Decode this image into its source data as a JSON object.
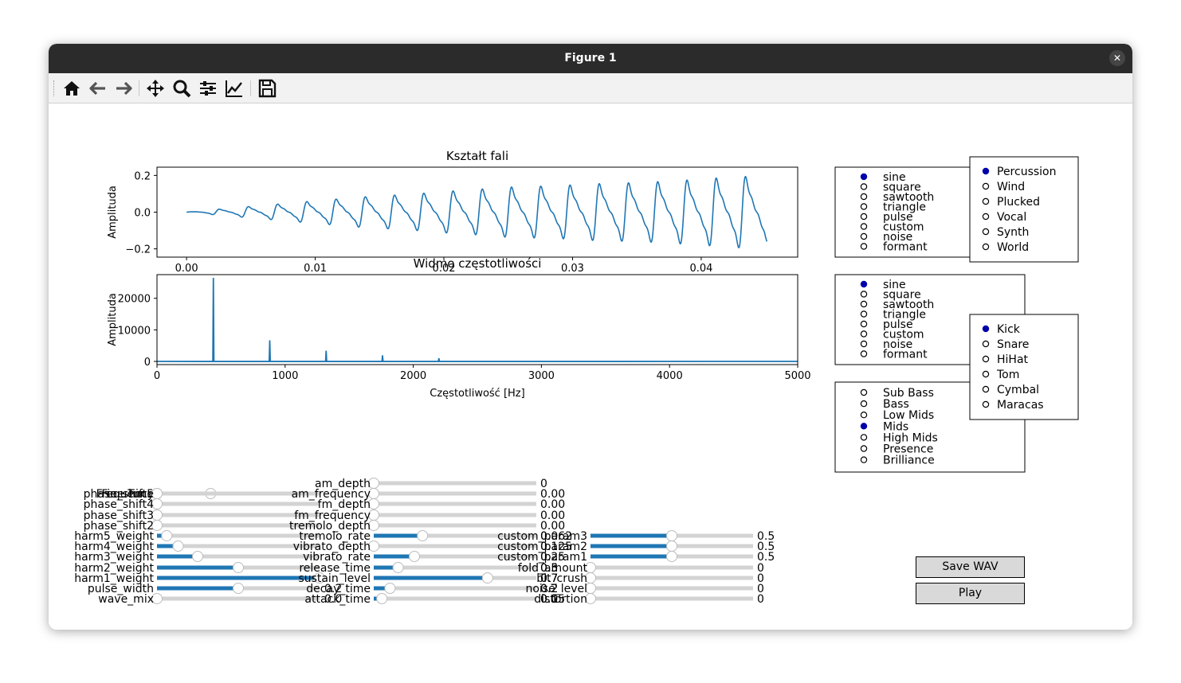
{
  "window": {
    "title": "Figure 1",
    "close_icon": "close-icon"
  },
  "toolbar": {
    "buttons": [
      {
        "name": "home-icon"
      },
      {
        "name": "back-icon"
      },
      {
        "name": "forward-icon"
      },
      {
        "name": "pan-icon"
      },
      {
        "name": "zoom-icon"
      },
      {
        "name": "configure-subplots-icon"
      },
      {
        "name": "edit-axis-icon"
      },
      {
        "name": "save-icon"
      }
    ]
  },
  "colors": {
    "line": "#1f77b4",
    "radio_active": "#0000aa",
    "slider_track": "#d3d3d3",
    "button_bg": "#d9d9d9"
  },
  "chart_data": [
    {
      "type": "line",
      "title": "Kształt fali",
      "xlabel": "",
      "ylabel": "Amplituda",
      "xlim": [
        -0.0023,
        0.0475
      ],
      "ylim": [
        -0.245,
        0.245
      ],
      "xticks": [
        0.0,
        0.01,
        0.02,
        0.03,
        0.04
      ],
      "xtick_labels": [
        "0.00",
        "0.01",
        "0.02",
        "0.03",
        "0.04"
      ],
      "yticks": [
        0.2,
        0.0,
        -0.2
      ],
      "ytick_labels": [
        "0.2",
        "0.0",
        "−0.2"
      ],
      "series": [
        {
          "peak_times": [
            0.0021,
            0.0043,
            0.0066,
            0.0088,
            0.0111,
            0.0133,
            0.0156,
            0.0178,
            0.0201,
            0.0223,
            0.0246,
            0.0268,
            0.0291,
            0.0313,
            0.0336,
            0.0358,
            0.0381,
            0.0403,
            0.0426
          ],
          "peak_amplitudes": [
            0.015,
            0.03,
            0.045,
            0.06,
            0.075,
            0.09,
            0.1,
            0.11,
            0.125,
            0.135,
            0.15,
            0.155,
            0.16,
            0.17,
            0.175,
            0.18,
            0.19,
            0.2,
            0.215
          ],
          "x_end": 0.045
        }
      ]
    },
    {
      "type": "line",
      "title": "Widmo częstotliwości",
      "xlabel": "Częstotliwość [Hz]",
      "ylabel": "Amplituda",
      "xlim": [
        0,
        5000
      ],
      "ylim": [
        -1000,
        27500
      ],
      "xticks": [
        0,
        1000,
        2000,
        3000,
        4000,
        5000
      ],
      "xtick_labels": [
        "0",
        "1000",
        "2000",
        "3000",
        "4000",
        "5000"
      ],
      "yticks": [
        20000,
        10000,
        0
      ],
      "ytick_labels": [
        "20000",
        "10000",
        "0"
      ],
      "series": [
        {
          "x": [
            440,
            880,
            1320,
            1760,
            2200
          ],
          "y": [
            26500,
            6700,
            3400,
            1900,
            1000
          ]
        }
      ]
    }
  ],
  "radios": {
    "wave1": {
      "options": [
        "sine",
        "square",
        "sawtooth",
        "triangle",
        "pulse",
        "custom",
        "noise",
        "formant"
      ],
      "selected": 0
    },
    "category": {
      "options": [
        "Percussion",
        "Wind",
        "Plucked",
        "Vocal",
        "Synth",
        "World"
      ],
      "selected": 0
    },
    "wave2": {
      "options": [
        "sine",
        "square",
        "sawtooth",
        "triangle",
        "pulse",
        "custom",
        "noise",
        "formant"
      ],
      "selected": 0
    },
    "drum": {
      "options": [
        "Kick",
        "Snare",
        "HiHat",
        "Tom",
        "Cymbal",
        "Maracas"
      ],
      "selected": 0
    },
    "band": {
      "options": [
        "Sub Bass",
        "Bass",
        "Low Mids",
        "Mids",
        "High Mids",
        "Presence",
        "Brilliance"
      ],
      "selected": 3
    }
  },
  "sliders": {
    "col1": [
      {
        "label": "Frequency",
        "value": 440,
        "frac": 0.33,
        "value_text": ""
      },
      {
        "label": "phase_shift5",
        "value": 0,
        "frac": 0,
        "value_text": ""
      },
      {
        "label": "Fine Tune",
        "value": 0,
        "frac": 0,
        "value_text": ""
      },
      {
        "label": "phase_shift4",
        "value": 0,
        "frac": 0,
        "value_text": ""
      },
      {
        "label": "phase_shift3",
        "value": 0,
        "frac": 0,
        "value_text": ""
      },
      {
        "label": "phase_shift2",
        "value": 0,
        "frac": 0,
        "value_text": ""
      },
      {
        "label": "harm5_weight",
        "value": 0.06,
        "frac": 0.06,
        "value_text": ""
      },
      {
        "label": "harm4_weight",
        "value": 0.13,
        "frac": 0.13,
        "value_text": ""
      },
      {
        "label": "harm3_weight",
        "value": 0.25,
        "frac": 0.25,
        "value_text": ""
      },
      {
        "label": "harm2_weight",
        "value": 0.5,
        "frac": 0.5,
        "value_text": ""
      },
      {
        "label": "harm1_weight",
        "value": 1.0,
        "frac": 1.0,
        "value_text": ""
      },
      {
        "label": "pulse_width",
        "value": 0.5,
        "frac": 0.5,
        "value_text": ""
      },
      {
        "label": "wave_mix",
        "value": 0,
        "frac": 0,
        "value_text": ""
      }
    ],
    "col2": [
      {
        "label": "am_depth",
        "value": 0,
        "frac": 0,
        "value_text": "0"
      },
      {
        "label": "am_frequency",
        "value": 0,
        "frac": 0,
        "value_text": "0.00"
      },
      {
        "label": "fm_depth",
        "value": 0,
        "frac": 0,
        "value_text": "0.00"
      },
      {
        "label": "fm_frequency",
        "value": 0,
        "frac": 0,
        "value_text": "0.00"
      },
      {
        "label": "tremolo_depth",
        "value": 0,
        "frac": 0,
        "value_text": "0.00"
      },
      {
        "label": "tremolo_rate",
        "value": 0.3,
        "frac": 0.3,
        "value_text": "0.062"
      },
      {
        "label": "vibrato_depth",
        "value": 0,
        "frac": 0,
        "value_text": "0.125"
      },
      {
        "label": "vibrato_rate",
        "value": 0.25,
        "frac": 0.25,
        "value_text": "0.25"
      },
      {
        "label": "release_time",
        "value": 0.15,
        "frac": 0.15,
        "value_text": "0.5"
      },
      {
        "label": "sustain_level",
        "value": 0.7,
        "frac": 0.7,
        "value_text": "0.7"
      },
      {
        "label": "decay_time",
        "value": 0.1,
        "frac": 0.1,
        "value_text": "0.2"
      },
      {
        "label": "attack_time",
        "value": 0.05,
        "frac": 0.05,
        "value_text": "0.1"
      }
    ],
    "col3": [
      {
        "label": "custom_param3",
        "value": 0.5,
        "frac": 0.5,
        "value_text": "0.5"
      },
      {
        "label": "custom_param2",
        "value": 0.5,
        "frac": 0.5,
        "value_text": "0.5"
      },
      {
        "label": "custom_param1",
        "value": 0.5,
        "frac": 0.5,
        "value_text": "0.5"
      },
      {
        "label": "fold_amount",
        "value": 0,
        "frac": 0,
        "value_text": "0"
      },
      {
        "label": "bit_crush",
        "value": 0,
        "frac": 0,
        "value_text": "0"
      },
      {
        "label": "noise_level",
        "value": 0,
        "frac": 0,
        "value_text": "0"
      },
      {
        "label": "distortion",
        "value": 0,
        "frac": 0,
        "value_text": "0"
      }
    ],
    "overlap_values": {
      "col2_attack": "0.0",
      "col2_decay": "0.2",
      "col3_custom3": "0",
      "col3_custom2": "0",
      "col3_custom1": "0",
      "col3_fold": "0.3",
      "col3_bitcrush": "0.7",
      "col3_noise": "0.2",
      "col3_distortion": "0.05"
    }
  },
  "buttons": {
    "save": "Save WAV",
    "play": "Play"
  }
}
